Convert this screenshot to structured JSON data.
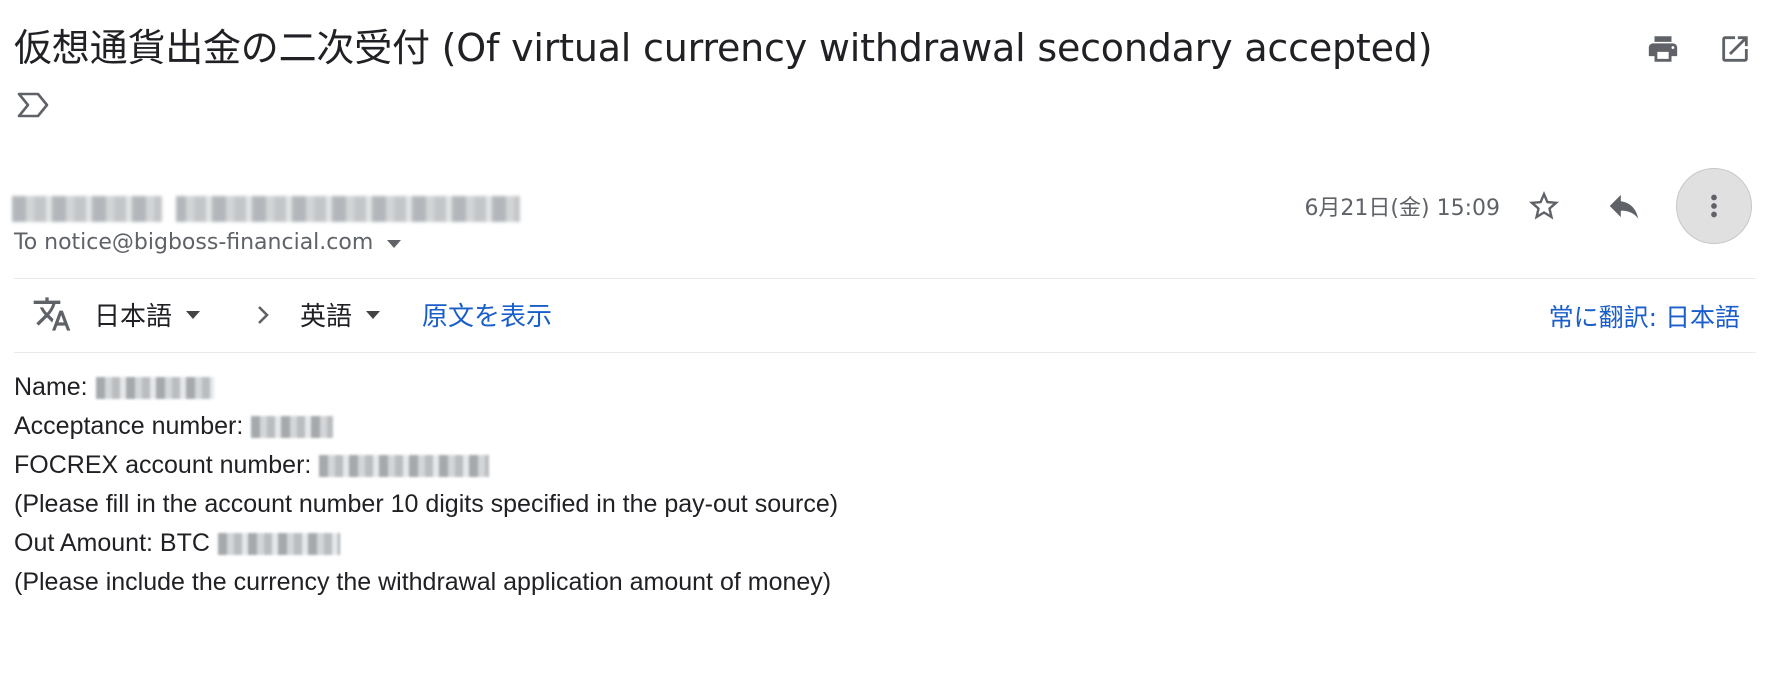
{
  "email": {
    "subject": "仮想通貨出金の二次受付 (Of virtual currency withdrawal secondary accepted)",
    "to": "To notice@bigboss-financial.com",
    "date": "6月21日(金) 15:09"
  },
  "translation": {
    "source_lang": "日本語",
    "target_lang": "英語",
    "show_original": "原文を表示",
    "always_translate": "常に翻訳: 日本語"
  },
  "body": {
    "name_label": "Name:",
    "acceptance_label": "Acceptance number:",
    "account_label": "FOCREX account number:",
    "account_note": "(Please fill in the account number 10 digits specified in the pay-out source)",
    "amount_label": "Out Amount: BTC",
    "amount_note": "(Please include the currency the withdrawal application amount of money)"
  },
  "icons": {
    "print": "print-icon",
    "open_new_window": "open-in-new-window-icon",
    "label": "label-icon",
    "star": "star-icon",
    "reply": "reply-icon",
    "more": "more-vertical-icon",
    "translate": "translate-icon",
    "chevron": "chevron-right-icon"
  },
  "colors": {
    "link_blue": "#1a5ec9",
    "text_gray": "#5f6368",
    "icon_gray": "#5f6368"
  }
}
